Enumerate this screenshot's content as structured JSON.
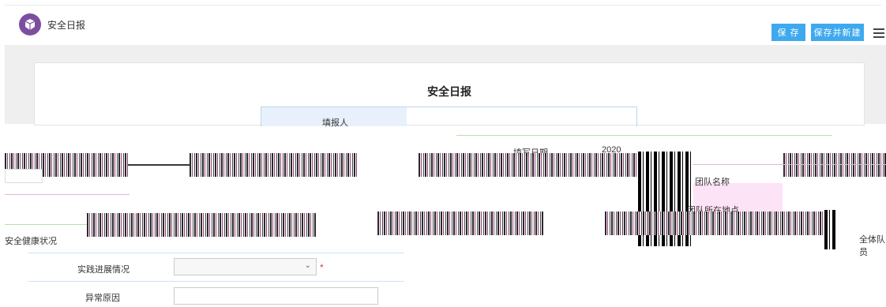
{
  "header": {
    "app_title": "安全日报",
    "save_label": "保 存",
    "save_new_label": "保存并新建"
  },
  "form": {
    "title": "安全日报",
    "labels": {
      "filler": "填报人",
      "fill_date": "填写日期",
      "date_value": "2020",
      "team_name": "团队名称",
      "team_location": "团队所在地点",
      "safety_health": "安全健康状况",
      "all_members": "全体队员",
      "practice_progress": "实践进展情况",
      "abnormal_reason": "异常原因"
    },
    "required_mark": "*",
    "progress_select": {
      "value": ""
    },
    "reason_input": {
      "value": ""
    }
  },
  "colors": {
    "accent": "#3fa9ef",
    "logo": "#7b4fa0",
    "required": "#e0393e"
  },
  "icons": {
    "logo": "box-icon",
    "menu": "list-menu-icon",
    "select": "chevron-down-icon"
  }
}
